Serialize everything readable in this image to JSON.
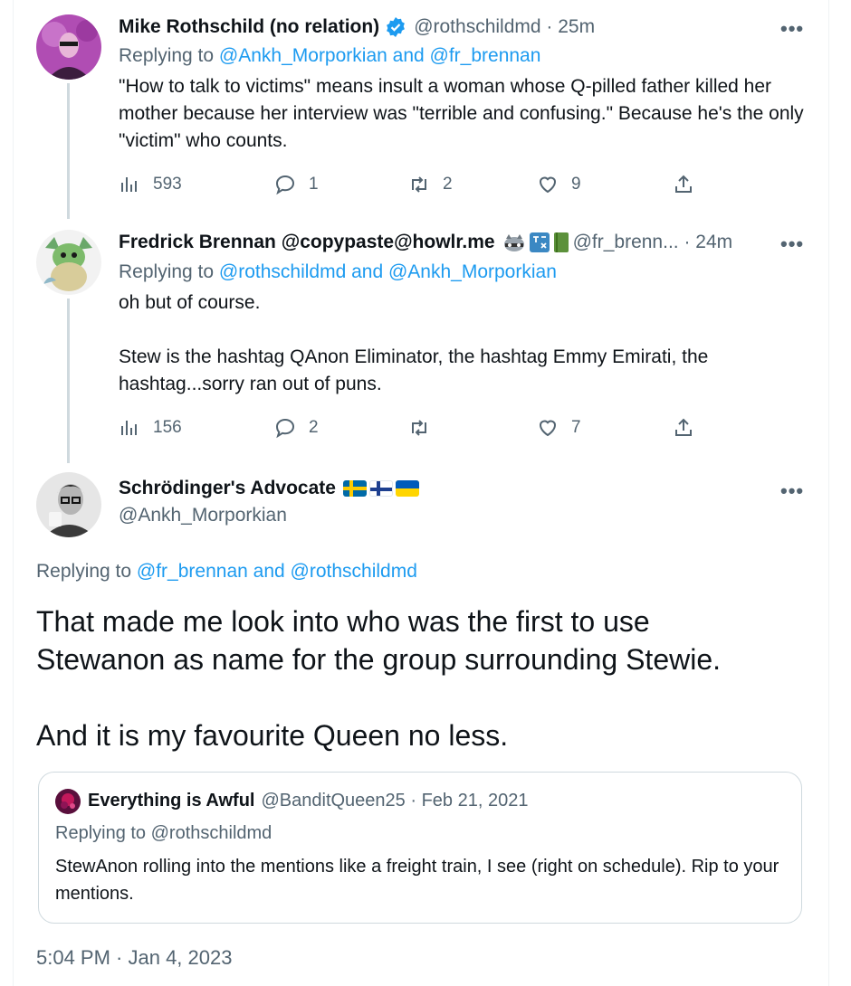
{
  "tweets": [
    {
      "name": "Mike Rothschild (no relation)",
      "handle": "@rothschildmd",
      "time": "25m",
      "reply_prefix": "Replying to ",
      "reply_to": "@Ankh_Morporkian and @fr_brennan",
      "text": "\"How to talk to victims\" means insult a woman whose Q-pilled father killed her mother because her interview was \"terrible and confusing.\" Because he's the only \"victim\" who counts.",
      "views": "593",
      "replies": "1",
      "retweets": "2",
      "likes": "9"
    },
    {
      "name": "Fredrick Brennan @copypaste@howlr.me",
      "handle": "@fr_brenn...",
      "time": "24m",
      "reply_prefix": "Replying to ",
      "reply_to": "@rothschildmd and @Ankh_Morporkian",
      "text_line1": "oh but of course.",
      "text_line2": "Stew is the hashtag QAnon Eliminator, the hashtag Emmy Emirati, the hashtag...sorry ran out of puns.",
      "views": "156",
      "replies": "2",
      "retweets": "",
      "likes": "7"
    }
  ],
  "main_tweet": {
    "name": "Schrödinger's Advocate",
    "handle": "@Ankh_Morporkian",
    "reply_prefix": "Replying to ",
    "reply_to": "@fr_brennan and @rothschildmd",
    "text_p1": "That made me look into who was the first to use Stewanon as name for the group surrounding Stewie.",
    "text_p2": "And it is my favourite Queen no less.",
    "timestamp": "5:04 PM · Jan 4, 2023"
  },
  "quoted_tweet": {
    "name": "Everything is Awful",
    "handle": "@BanditQueen25",
    "date": "Feb 21, 2021",
    "reply_line": "Replying to @rothschildmd",
    "text": "StewAnon rolling into the mentions like a freight train, I see (right on schedule). Rip to your mentions."
  },
  "separator": " · ",
  "more_label": "•••",
  "colors": {
    "link": "#1d9bf0",
    "secondary": "#536471",
    "verified": "#1d9bf0"
  }
}
